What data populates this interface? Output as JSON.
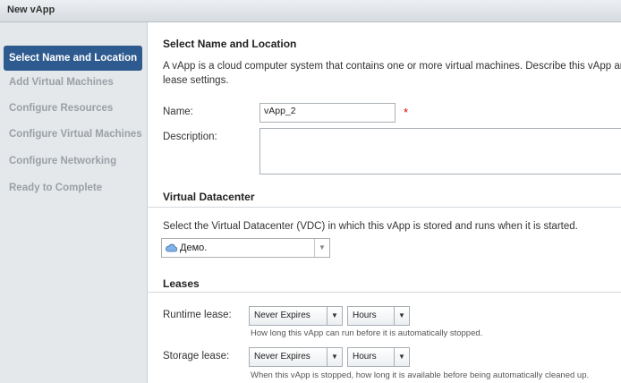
{
  "window": {
    "title": "New vApp"
  },
  "sidebar": {
    "items": [
      {
        "label": "Select Name and Location",
        "active": true
      },
      {
        "label": "Add Virtual Machines"
      },
      {
        "label": "Configure Resources"
      },
      {
        "label": "Configure Virtual Machines"
      },
      {
        "label": "Configure Networking"
      },
      {
        "label": "Ready to Complete"
      }
    ]
  },
  "main": {
    "heading": "Select Name and Location",
    "intro_line1": "A vApp is a cloud computer system that contains one or more virtual machines. Describe this vApp and",
    "intro_line2": "lease settings.",
    "name_label": "Name:",
    "name_value": "vApp_2",
    "required_marker": "*",
    "description_label": "Description:",
    "description_value": "",
    "vdc_heading": "Virtual Datacenter",
    "vdc_text": "Select the Virtual Datacenter (VDC) in which this vApp is stored and runs when it is started.",
    "vdc_value": "Демо.",
    "leases_heading": "Leases",
    "runtime_label": "Runtime lease:",
    "runtime_value": "Never Expires",
    "runtime_unit": "Hours",
    "runtime_hint": "How long this vApp can run before it is automatically stopped.",
    "storage_label": "Storage lease:",
    "storage_value": "Never Expires",
    "storage_unit": "Hours",
    "storage_hint": "When this vApp is stopped, how long it is available before being automatically cleaned up."
  },
  "colors": {
    "accent": "#2e5b8f",
    "required": "#dd0000"
  },
  "icons": {
    "vdc": "cloud-icon",
    "dropdown": "chevron-down-icon"
  }
}
